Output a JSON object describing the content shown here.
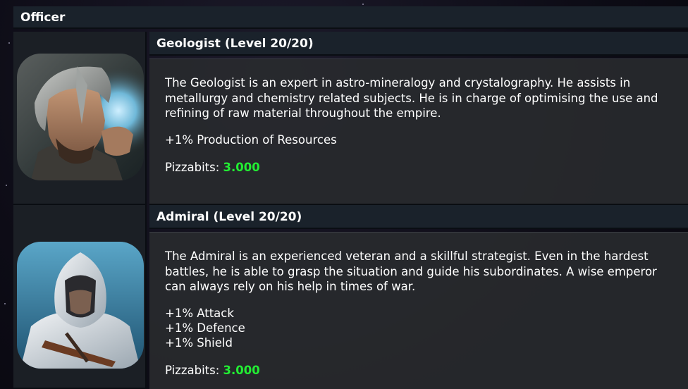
{
  "panel": {
    "title": "Officer"
  },
  "officers": [
    {
      "name": "Geologist (Level 20/20)",
      "portrait_icon": "geologist-portrait",
      "description": "The Geologist is an expert in astro-mineralogy and crystalography. He assists in metallurgy and chemistry related subjects. He is in charge of optimising the use and refining of raw material throughout the empire.",
      "bonuses": [
        "+1% Production of Resources"
      ],
      "cost_label": "Pizzabits:",
      "cost_value": "3.000"
    },
    {
      "name": "Admiral (Level 20/20)",
      "portrait_icon": "admiral-portrait",
      "description": "The Admiral is an experienced veteran and a skillful strategist. Even in the hardest battles, he is able to grasp the situation and guide his subordinates. A wise emperor can always rely on his help in times of war.",
      "bonuses": [
        "+1% Attack",
        "+1% Defence",
        "+1% Shield"
      ],
      "cost_label": "Pizzabits:",
      "cost_value": "3.000"
    }
  ],
  "colors": {
    "header_bg": "#1a222b",
    "cell_bg": "#28292e",
    "cost_value": "#22ee33"
  }
}
